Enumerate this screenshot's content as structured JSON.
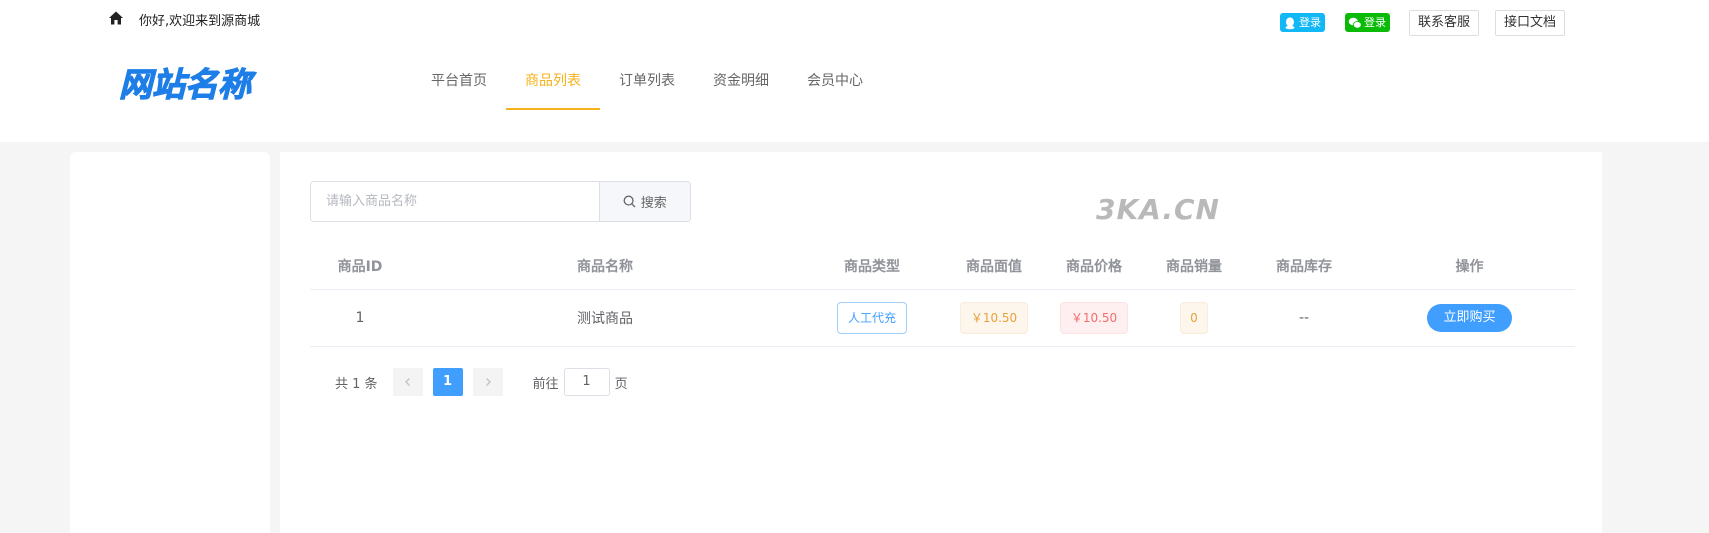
{
  "topbar": {
    "welcome": "你好,欢迎来到源商城",
    "qq_login": "登录",
    "wechat_login": "登录",
    "service_btn": "联系客服",
    "docs_btn": "接口文档"
  },
  "logo": {
    "text": "网站名称",
    "color": "#1e7ee8"
  },
  "nav": {
    "items": [
      {
        "label": "平台首页"
      },
      {
        "label": "商品列表"
      },
      {
        "label": "订单列表"
      },
      {
        "label": "资金明细"
      },
      {
        "label": "会员中心"
      }
    ],
    "active_index": 1,
    "active_color": "#f6b21b"
  },
  "search": {
    "placeholder": "请输入商品名称",
    "value": "",
    "button": "搜索"
  },
  "watermark": "3KA.CN",
  "table": {
    "headers": [
      "商品ID",
      "商品名称",
      "商品类型",
      "商品面值",
      "商品价格",
      "商品销量",
      "商品库存",
      "操作"
    ],
    "rows": [
      {
        "id": "1",
        "name": "测试商品",
        "type": "人工代充",
        "face_value": "￥10.50",
        "price": "￥10.50",
        "sales": "0",
        "stock": "--",
        "action": "立即购买"
      }
    ]
  },
  "pagination": {
    "total": "共 1 条",
    "current": "1",
    "goto_label": "前往",
    "goto_value": "1",
    "page_label": "页"
  },
  "colors": {
    "accent": "#409eff",
    "brand_yellow": "#f6b21b",
    "qq_blue": "#12b7f5",
    "wechat_green": "#09bb07"
  },
  "icons": [
    "home-icon",
    "qq-icon",
    "wechat-icon",
    "search-icon",
    "chevron-left-icon",
    "chevron-right-icon"
  ]
}
